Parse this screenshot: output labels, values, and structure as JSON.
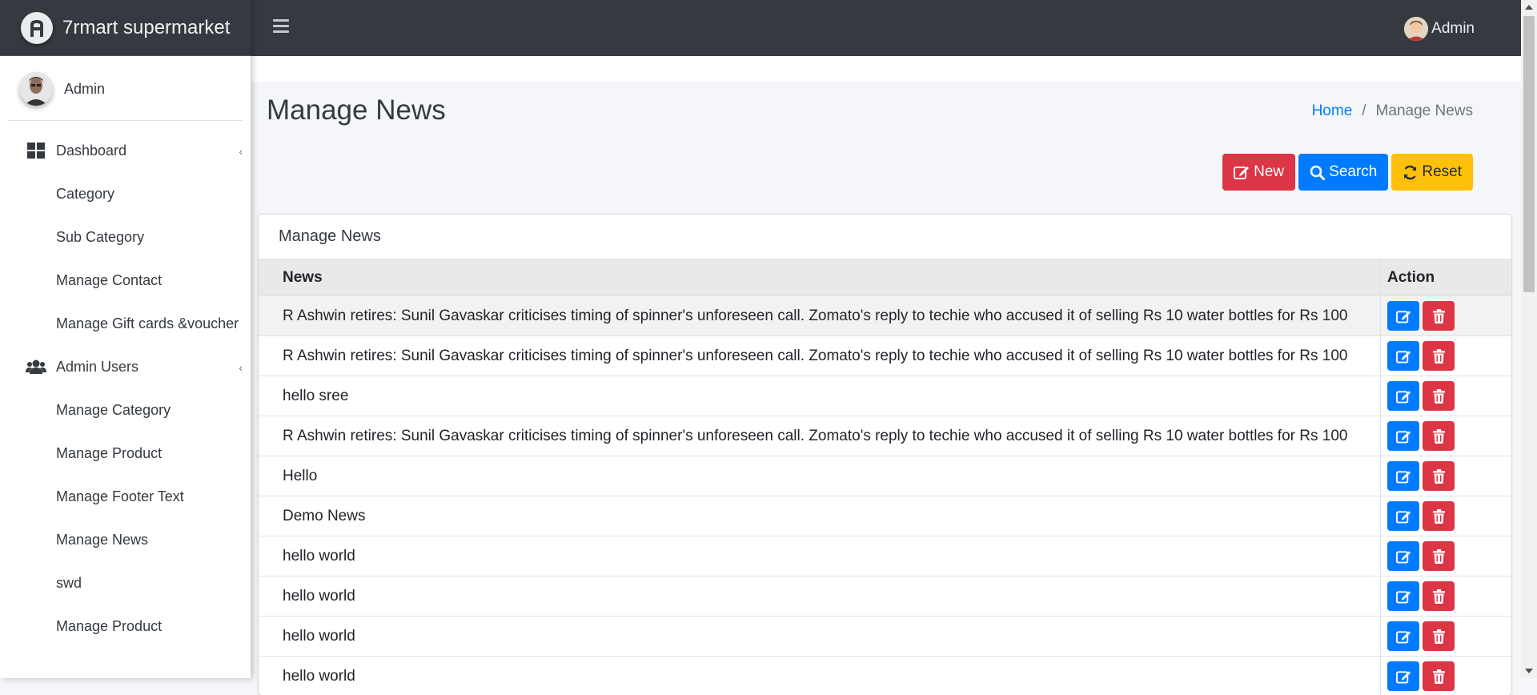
{
  "brand": {
    "name": "7rmart supermarket"
  },
  "sidebar": {
    "user": "Admin",
    "items": [
      {
        "label": "Dashboard",
        "type": "parent",
        "icon": "dashboard-icon"
      },
      {
        "label": "Category",
        "type": "child"
      },
      {
        "label": "Sub Category",
        "type": "child"
      },
      {
        "label": "Manage Contact",
        "type": "child"
      },
      {
        "label": "Manage Gift cards &voucher",
        "type": "child"
      },
      {
        "label": "Admin Users",
        "type": "parent",
        "icon": "users-icon"
      },
      {
        "label": "Manage Category",
        "type": "child"
      },
      {
        "label": "Manage Product",
        "type": "child"
      },
      {
        "label": "Manage Footer Text",
        "type": "child"
      },
      {
        "label": "Manage News",
        "type": "child"
      },
      {
        "label": "swd",
        "type": "child"
      },
      {
        "label": "Manage Product",
        "type": "child"
      }
    ]
  },
  "topbar": {
    "user": "Admin"
  },
  "page": {
    "title": "Manage News",
    "breadcrumb": {
      "home": "Home",
      "current": "Manage News"
    }
  },
  "actions": {
    "new": "New",
    "search": "Search",
    "reset": "Reset"
  },
  "card": {
    "title": "Manage News",
    "columns": [
      "News",
      "Action"
    ],
    "rows": [
      "R Ashwin retires: Sunil Gavaskar criticises timing of spinner's unforeseen call. Zomato's reply to techie who accused it of selling Rs 10 water bottles for Rs 100",
      "R Ashwin retires: Sunil Gavaskar criticises timing of spinner's unforeseen call. Zomato's reply to techie who accused it of selling Rs 10 water bottles for Rs 100",
      "hello sree",
      "R Ashwin retires: Sunil Gavaskar criticises timing of spinner's unforeseen call. Zomato's reply to techie who accused it of selling Rs 10 water bottles for Rs 100",
      "Hello",
      "Demo News",
      "hello world",
      "hello world",
      "hello world",
      "hello world"
    ]
  },
  "colors": {
    "topbar": "#343a40",
    "primary": "#007bff",
    "danger": "#dc3545",
    "warning": "#ffc107"
  }
}
